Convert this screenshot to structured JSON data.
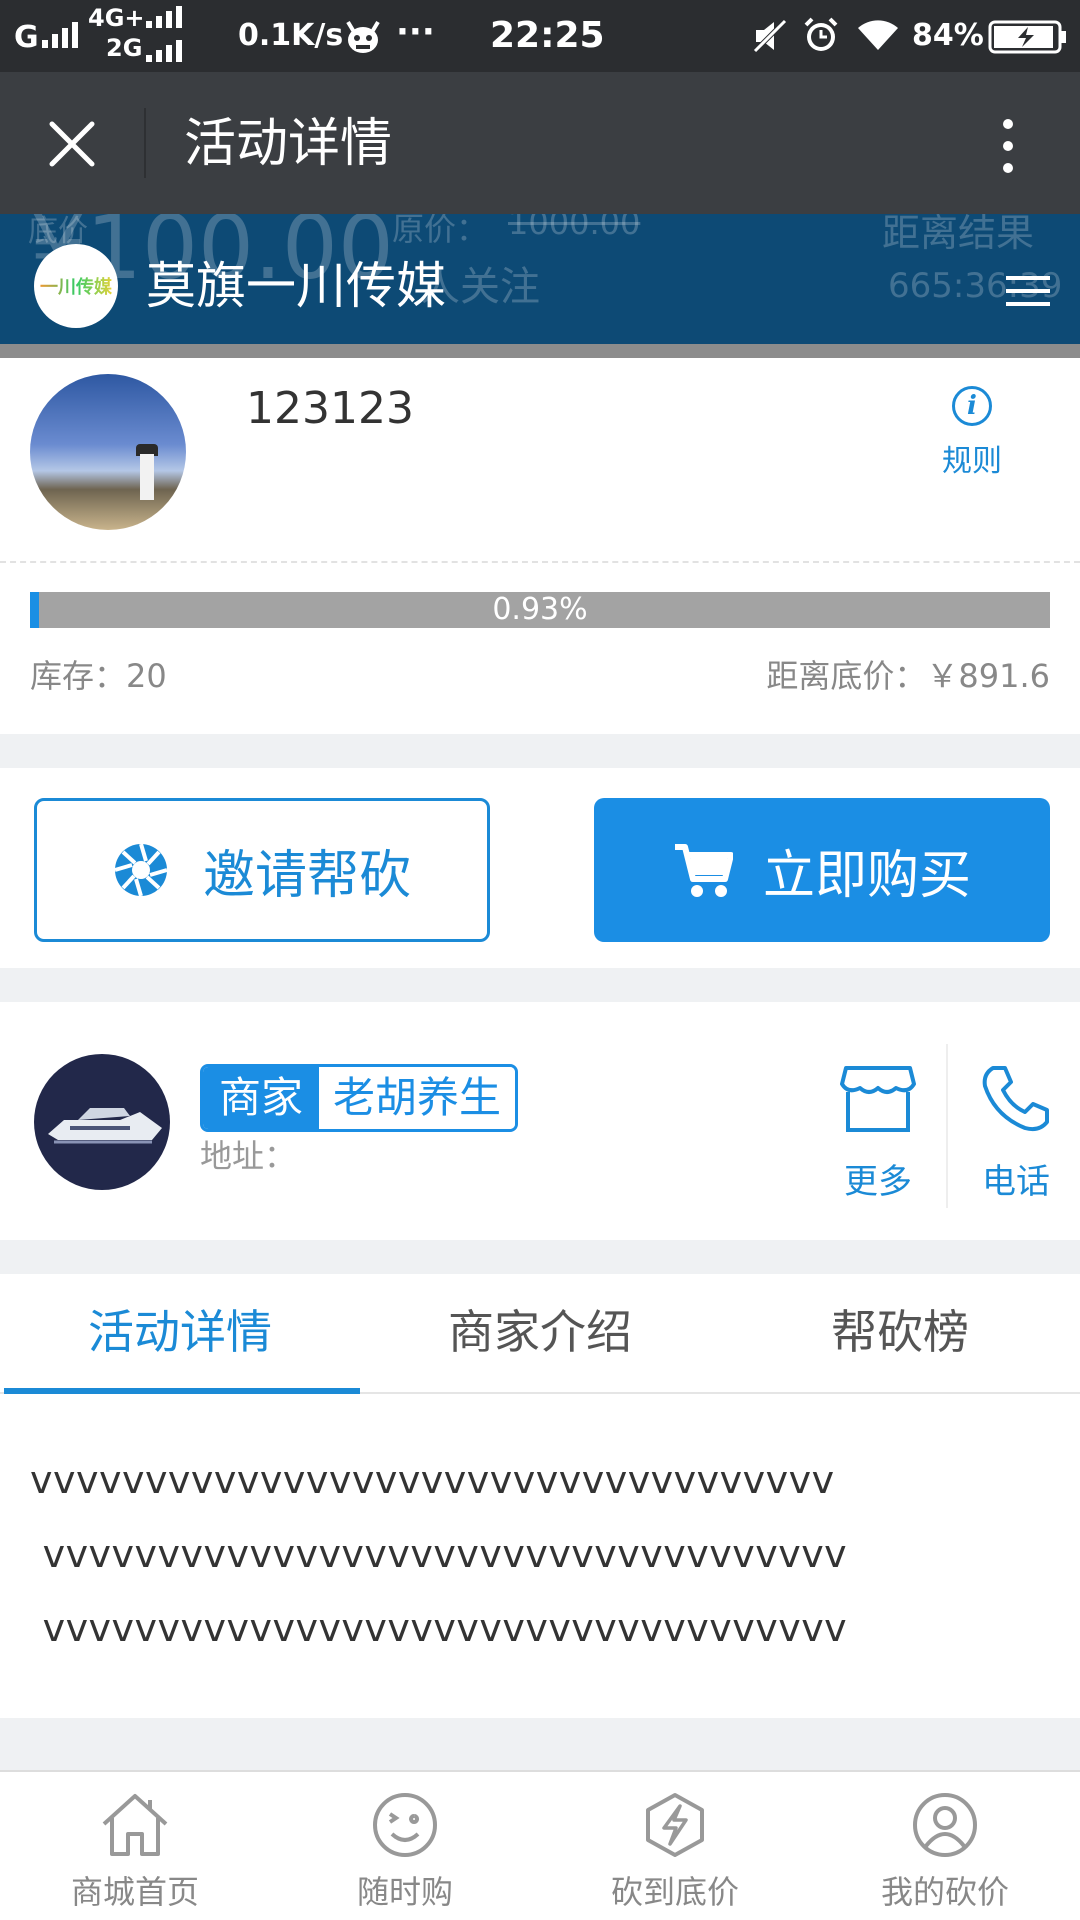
{
  "status_bar": {
    "carrier_1": "G",
    "carrier_2_top": "4G+",
    "carrier_2_bottom": "2G",
    "net_speed": "0.1K/s",
    "more": "···",
    "time": "22:25",
    "battery": "84%"
  },
  "app_bar": {
    "title": "活动详情"
  },
  "shop_header": {
    "shop_name": "莫旗一川传媒",
    "logo_text": "一川传媒",
    "ghost_price_label": "底价",
    "ghost_price": "¥100.00",
    "ghost_original_label": "原价：",
    "ghost_original": "1000.00",
    "ghost_follow": "人关注",
    "ghost_countdown_label": "距离结果",
    "ghost_countdown": "665:36:39"
  },
  "product": {
    "name": "123123",
    "rules_label": "规则",
    "progress_text": "0.93%",
    "progress_value": 0.0093,
    "stock": "库存：20",
    "distance_to_floor": "距离底价：￥891.6"
  },
  "actions": {
    "invite_label": "邀请帮砍",
    "buy_label": "立即购买"
  },
  "merchant": {
    "badge_key": "商家",
    "badge_value": "老胡养生",
    "address": "地址：",
    "more_label": "更多",
    "call_label": "电话"
  },
  "tabs": [
    {
      "label": "活动详情",
      "active": true
    },
    {
      "label": "商家介绍",
      "active": false
    },
    {
      "label": "帮砍榜",
      "active": false
    }
  ],
  "content": {
    "lines": [
      "vvvvvvvvvvvvvvvvvvvvvvvvvvvvvvvvvvv",
      " vvvvvvvvvvvvvvvvvvvvvvvvvvvvvvvvvvv",
      " vvvvvvvvvvvvvvvvvvvvvvvvvvvvvvvvvvv"
    ]
  },
  "bottom_nav": [
    {
      "label": "商城首页",
      "icon": "home-icon"
    },
    {
      "label": "随时购",
      "icon": "smiley-icon"
    },
    {
      "label": "砍到底价",
      "icon": "lightning-icon"
    },
    {
      "label": "我的砍价",
      "icon": "user-icon"
    }
  ],
  "colors": {
    "accent": "#1b8ad6",
    "accent_fill": "#1b8ee4",
    "app_bar": "#3b3e42",
    "status_bar": "#2b2d30",
    "shop_header": "#0d4a75"
  }
}
